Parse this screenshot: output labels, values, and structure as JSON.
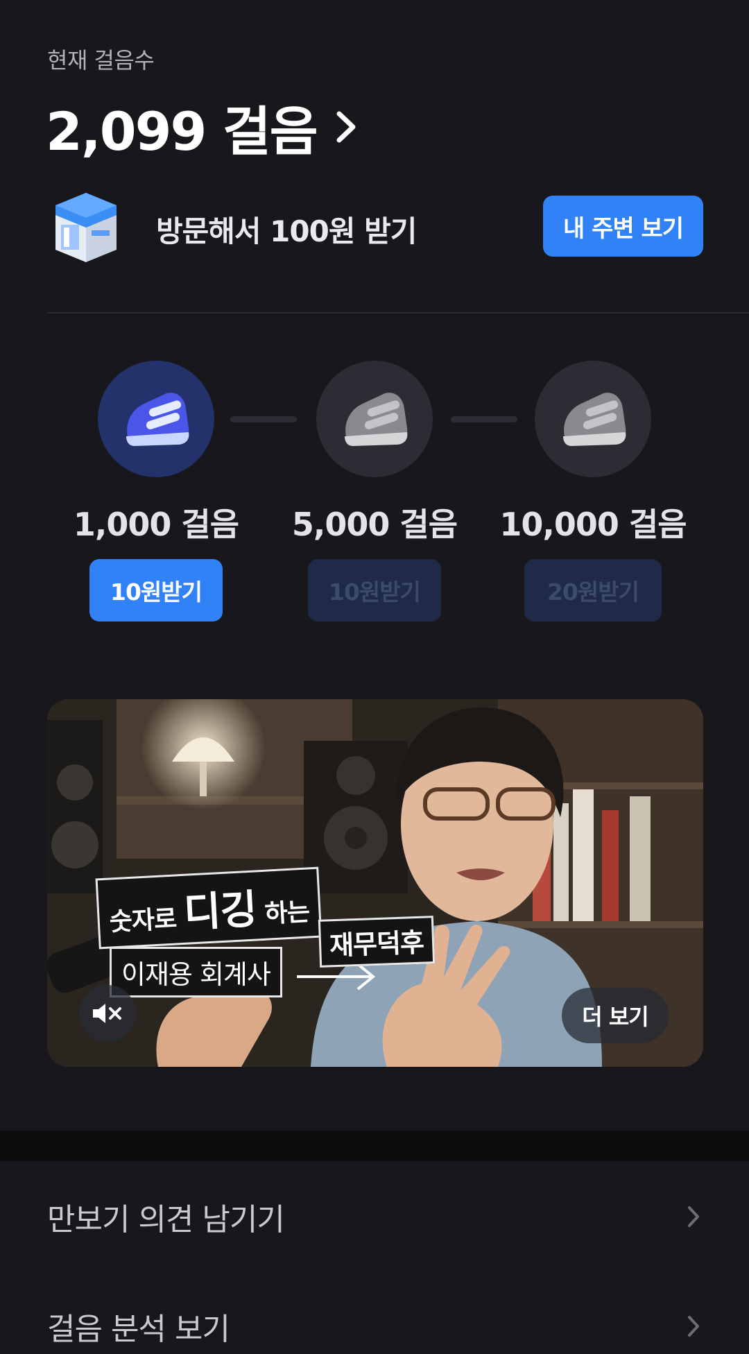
{
  "header": {
    "current_label": "현재 걸음수",
    "steps_value": "2,099 걸음"
  },
  "visit": {
    "text": "방문해서 100원 받기",
    "button_label": "내 주변 보기"
  },
  "milestones": [
    {
      "steps": "1,000 걸음",
      "button": "10원받기",
      "state": "active"
    },
    {
      "steps": "5,000 걸음",
      "button": "10원받기",
      "state": "inactive"
    },
    {
      "steps": "10,000 걸음",
      "button": "20원받기",
      "state": "inactive"
    }
  ],
  "video": {
    "caption_part1": "숫자로",
    "caption_big": "디깅",
    "caption_part2": "하는",
    "caption_line2": "재무덕후",
    "caption_name": "이재용 회계사",
    "more_label": "더 보기",
    "mute_icon": "mute-icon"
  },
  "menu": [
    {
      "label": "만보기 의견 남기기"
    },
    {
      "label": "걸음 분석 보기"
    }
  ],
  "colors": {
    "background": "#17171c",
    "accent": "#3182f6",
    "active_circle": "#23326a",
    "disabled_button": "#1e2a48"
  }
}
